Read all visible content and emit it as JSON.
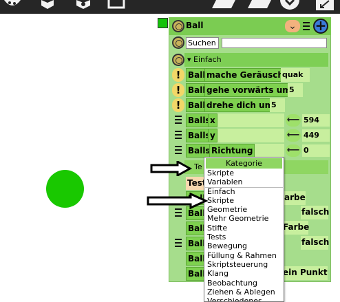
{
  "panel": {
    "title": "Ball",
    "search_label": "Suchen",
    "search_value": "",
    "category_row": "▾ Einfach"
  },
  "blocks": [
    {
      "target": "Ball",
      "text": "mache Geräusch",
      "extra": "quak",
      "icon": "warn-icon"
    },
    {
      "target": "Ball",
      "text": "gehe vorwärts um",
      "extra": "5",
      "icon": "warn-icon"
    },
    {
      "target": "Ball",
      "text": "drehe dich um",
      "extra": "5",
      "icon": "warn-icon"
    },
    {
      "target": "Balls",
      "text": "x",
      "value": "594",
      "icon": "list-icon"
    },
    {
      "target": "Balls",
      "text": "y",
      "value": "449",
      "icon": "list-icon"
    },
    {
      "target": "Balls",
      "text": "Richtung",
      "value": "0",
      "icon": "list-icon"
    }
  ],
  "partial": {
    "tests_row": "Te",
    "test_row": "Test",
    "ball_1": "Ball",
    "ball_2": "Ball",
    "ball_3": "Ball",
    "ball_4": "Ball",
    "ball_5": "Ball",
    "ball_6": "Ball",
    "farbe_1": "arbe",
    "falsch_1": "falsch",
    "farbe_2": "Farbe",
    "falsch_2": "falsch",
    "punkt": "ein Punkt"
  },
  "dropdown": {
    "title": "Kategorie",
    "recent": [
      "Skripte",
      "Variablen"
    ],
    "items": [
      "Einfach",
      "Skripte",
      "Geometrie",
      "Mehr Geometrie",
      "Stifte",
      "Tests",
      "Bewegung",
      "Füllung & Rahmen",
      "Skriptsteuerung",
      "Klang",
      "Beobachtung",
      "Ziehen & Ablegen",
      "Verschiedenes"
    ]
  },
  "colors": {
    "toolbar": "#262626",
    "panel_bg": "#a6dd8c",
    "block_green": "#7ed14f",
    "stage_ball": "#19c800",
    "accent_blue": "#3b7ad9"
  }
}
